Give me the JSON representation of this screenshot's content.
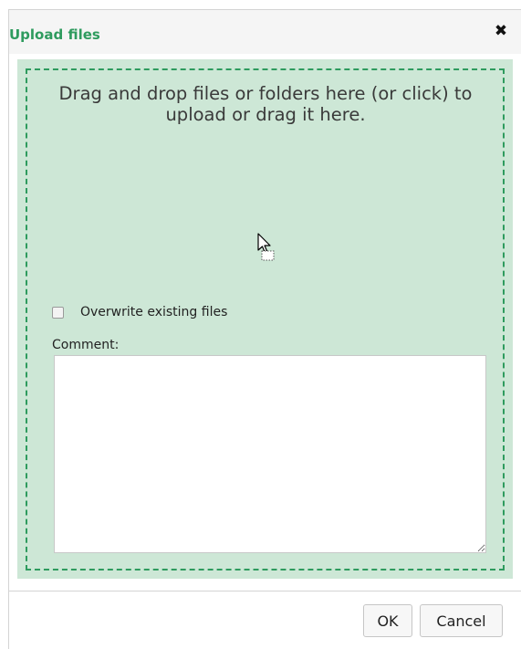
{
  "dialog": {
    "title": "Upload files",
    "close_icon": "close-icon"
  },
  "dropzone": {
    "instructions": "Drag and drop files or folders here (or click) to upload or drag it here.",
    "cursor_icon": "drag-copy-cursor-icon"
  },
  "options": {
    "overwrite_label": "Overwrite existing files",
    "overwrite_checked": false
  },
  "comment": {
    "label": "Comment:",
    "value": ""
  },
  "footer": {
    "ok_label": "OK",
    "cancel_label": "Cancel"
  },
  "colors": {
    "accent": "#2e9b5e",
    "dropzone_bg": "#cde7d6"
  }
}
